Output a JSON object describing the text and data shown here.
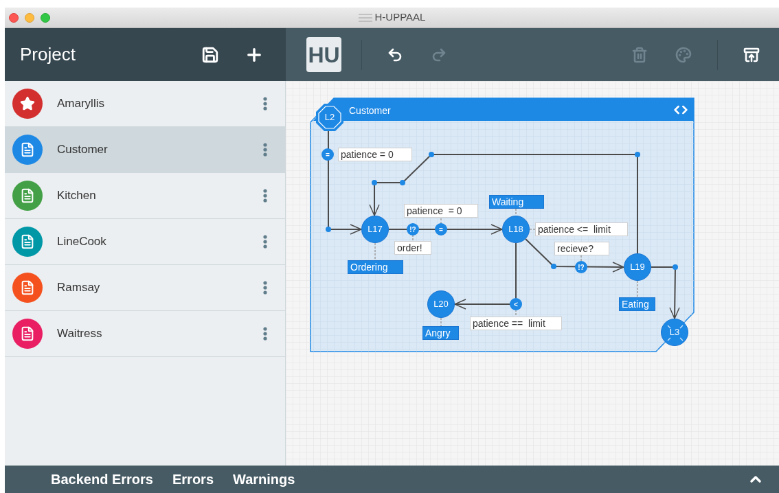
{
  "window": {
    "title": "H-UPPAAL"
  },
  "sidebar": {
    "title": "Project",
    "items": [
      {
        "label": "Amaryllis",
        "kind": "global",
        "color": "#d32f2f",
        "selected": false
      },
      {
        "label": "Customer",
        "kind": "template",
        "color": "#1e88e5",
        "selected": true
      },
      {
        "label": "Kitchen",
        "kind": "template",
        "color": "#43a047",
        "selected": false
      },
      {
        "label": "LineCook",
        "kind": "template",
        "color": "#0097a7",
        "selected": false
      },
      {
        "label": "Ramsay",
        "kind": "template",
        "color": "#f4511e",
        "selected": false
      },
      {
        "label": "Waitress",
        "kind": "template",
        "color": "#e91e63",
        "selected": false
      }
    ]
  },
  "toolbar": {
    "logo": "HU",
    "buttons": [
      {
        "kind": "undo",
        "disabled": false
      },
      {
        "kind": "redo",
        "disabled": true
      },
      {
        "kind": "delete",
        "disabled": true
      },
      {
        "kind": "palette",
        "disabled": true
      },
      {
        "kind": "archive",
        "disabled": false
      }
    ]
  },
  "template": {
    "name": "Customer",
    "locations": [
      {
        "label": "L2",
        "kind": "initial"
      },
      {
        "label": "L17",
        "kind": "normal",
        "name": "Ordering"
      },
      {
        "label": "L18",
        "kind": "normal",
        "name": "Waiting"
      },
      {
        "label": "L19",
        "kind": "normal",
        "name": "Eating"
      },
      {
        "label": "L20",
        "kind": "normal",
        "name": "Angry"
      },
      {
        "label": "L3",
        "kind": "final"
      }
    ],
    "nails": [
      {
        "symbol": "="
      },
      {
        "symbol": "!?"
      },
      {
        "symbol": "="
      },
      {
        "symbol": "!?"
      },
      {
        "symbol": "<"
      }
    ],
    "edge_labels": [
      "patience = 0",
      "patience  = 0",
      "order!",
      "patience <=  limit",
      "recieve?",
      "patience ==  limit"
    ]
  },
  "bottom_bar": {
    "tabs": [
      "Backend Errors",
      "Errors",
      "Warnings"
    ]
  }
}
